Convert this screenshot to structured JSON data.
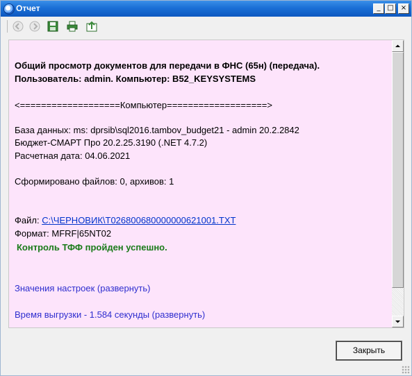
{
  "window": {
    "title": "Отчет"
  },
  "controls": {
    "minimize": "_",
    "maximize": "□",
    "close": "×"
  },
  "toolbar": {
    "buttons": [
      {
        "name": "back-icon"
      },
      {
        "name": "forward-icon"
      },
      {
        "name": "save-icon"
      },
      {
        "name": "print-icon"
      },
      {
        "name": "export-icon"
      }
    ]
  },
  "report": {
    "heading_line1": "Общий просмотр документов для передачи в ФНС (65н) (передача).",
    "heading_line2": "Пользователь: admin. Компьютер: B52_KEYSYSTEMS",
    "computer_divider": "<===================Компьютер===================>",
    "database": "База данных: ms: dprsib\\sql2016.tambov_budget21 - admin 20.2.2842",
    "product": "Бюджет-СМАРТ Про 20.2.25.3190 (.NET 4.7.2)",
    "calc_date": "Расчетная дата: 04.06.2021",
    "files_summary": "Сформировано файлов: 0, архивов: 1",
    "file_label": "Файл: ",
    "file_link": "C:\\ЧЕРНОВИК\\T026800680000000621001.TXT",
    "format": "Формат: MFRF|65NT02",
    "control_ok": "Контроль ТФФ пройден успешно.",
    "settings_link": "Значения настроек (развернуть)",
    "upload_time_link": "Время выгрузки - 1.584 секунды (развернуть)"
  },
  "footer": {
    "close_button": "Закрыть"
  },
  "colors": {
    "title_bar": "#1a6fd6",
    "content_bg": "#fde4fb",
    "link": "#0033cc",
    "success": "#1a7a1a",
    "expand_link": "#2e2ecf"
  }
}
